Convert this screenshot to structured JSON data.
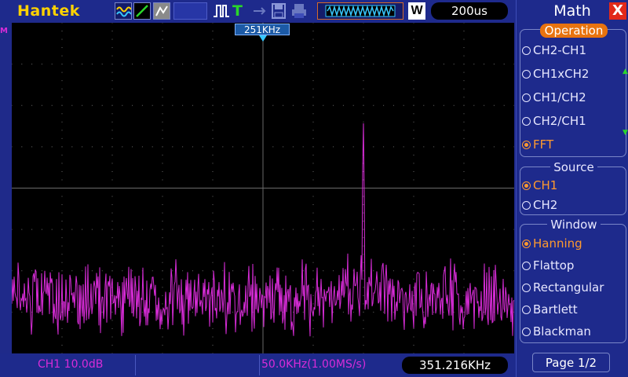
{
  "brand": "Hantek",
  "toolbar": {
    "icons": [
      "wave-display-icon",
      "vector-line-icon",
      "persistence-icon",
      "blank-slot-icon",
      "pulse-trigger-icon",
      "trigger-t-icon",
      "arrow-icon",
      "save-icon",
      "print-icon"
    ],
    "trigger_letter": "T",
    "mode_letter": "W",
    "timebase": "200us"
  },
  "scope": {
    "marker_label": "251KHz",
    "channel_marker": "M",
    "trace_color": "#d82cd8",
    "grid_color": "#6a6a6a"
  },
  "status": {
    "ch1": "CH1 10.0dB",
    "fft_span": "50.0KHz(1.00MS/s)",
    "frequency": "351.216KHz"
  },
  "menu": {
    "title": "Math",
    "close": "X",
    "operation_title": "Operation",
    "operations": [
      "CH2-CH1",
      "CH1xCH2",
      "CH1/CH2",
      "CH2/CH1",
      "FFT"
    ],
    "operation_selected": 4,
    "source_title": "Source",
    "sources": [
      "CH1",
      "CH2"
    ],
    "source_selected": 0,
    "window_title": "Window",
    "windows": [
      "Hanning",
      "Flattop",
      "Rectangular",
      "Bartlett",
      "Blackman"
    ],
    "window_selected": 0,
    "page": "Page 1/2"
  },
  "colors": {
    "background": "#1f2a8c",
    "accent_selected": "#ff9a2e",
    "brand": "#ffd200",
    "close": "#e22a1a"
  }
}
